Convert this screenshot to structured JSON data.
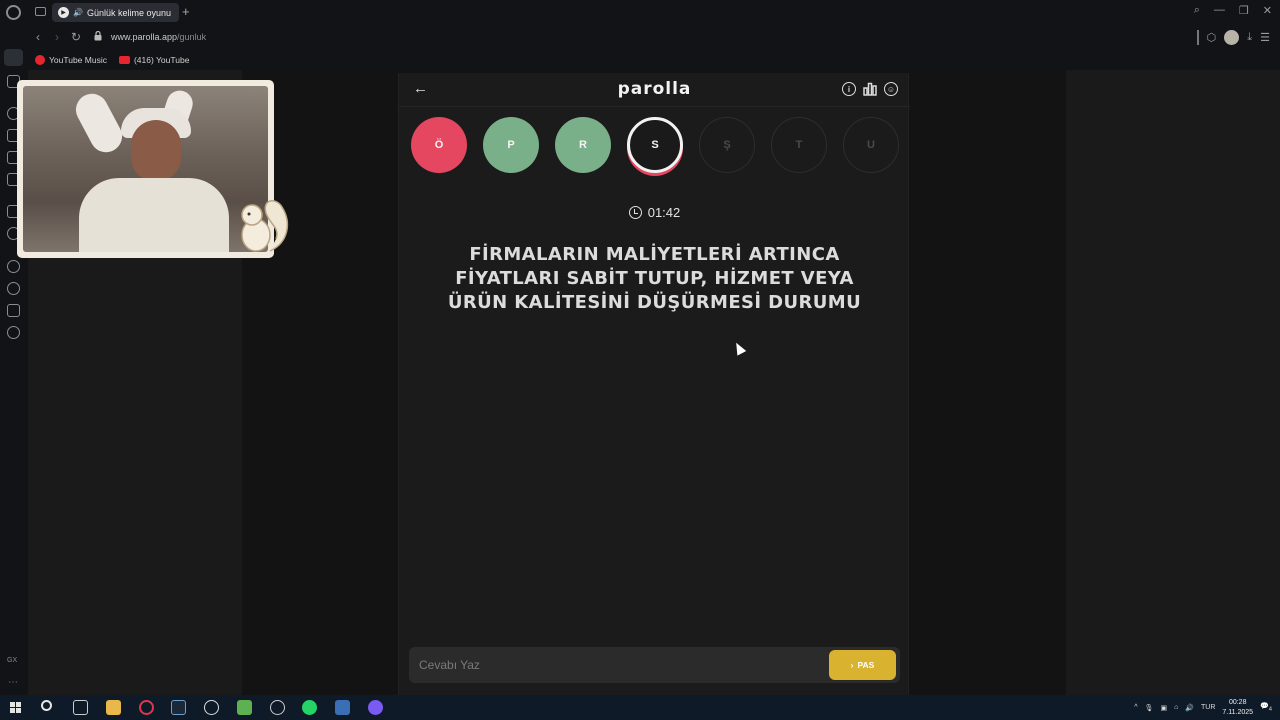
{
  "browser": {
    "tab_title": "Günlük kelime oyunu",
    "url_host": "www.parolla.app",
    "url_path": "/gunluk",
    "bookmarks": [
      {
        "label": "YouTube Music"
      },
      {
        "label": "(416) YouTube"
      }
    ],
    "sidebar_label": "GX"
  },
  "game": {
    "brand": "parolla",
    "letters": [
      {
        "char": "Ö",
        "state": "wrong"
      },
      {
        "char": "P",
        "state": "correct"
      },
      {
        "char": "R",
        "state": "correct"
      },
      {
        "char": "S",
        "state": "current"
      },
      {
        "char": "Ş",
        "state": "pending"
      },
      {
        "char": "T",
        "state": "pending"
      },
      {
        "char": "U",
        "state": "pending"
      }
    ],
    "timer": "01:42",
    "question": "FİRMALARIN MALİYETLERİ ARTINCA FİYATLARI SABİT TUTUP, HİZMET VEYA ÜRÜN KALİTESİNİ DÜŞÜRMESİ DURUMU",
    "answer_placeholder": "Cevabı Yaz",
    "pass_label": "PAS"
  },
  "taskbar": {
    "lang": "TUR",
    "time": "00:28",
    "date": "7.11.2025",
    "notifications": "4"
  },
  "colors": {
    "wrong": "#e4475f",
    "correct": "#7ab089",
    "pass_button": "#d9b230",
    "background": "#1b1b1b"
  }
}
